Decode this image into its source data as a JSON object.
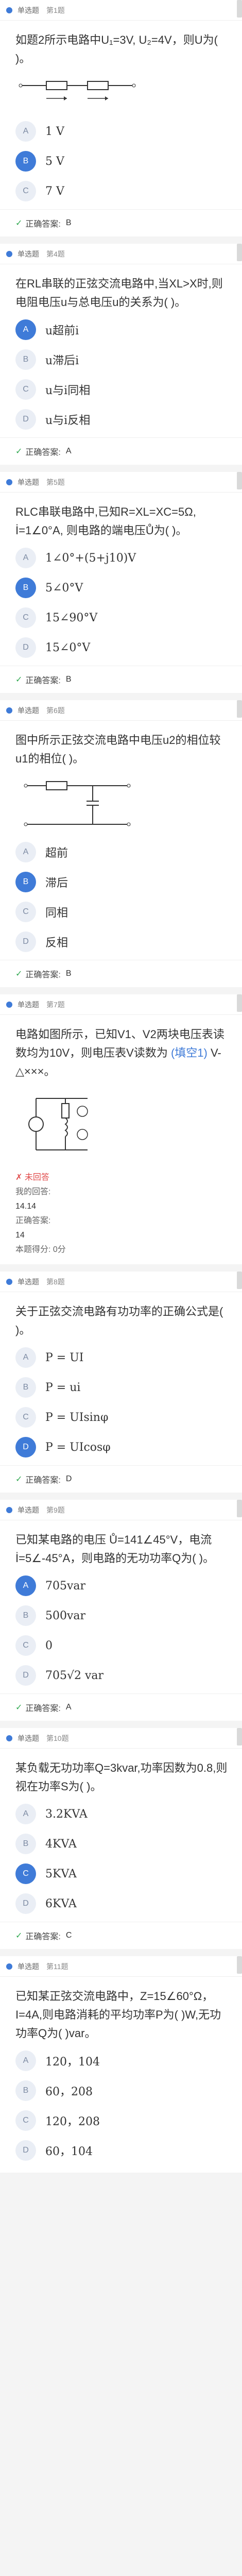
{
  "common": {
    "type": "单选题",
    "q_prefix": "第",
    "q_suffix": "题",
    "answered_correct": "正确答案:",
    "check": "✓"
  },
  "questions": [
    {
      "num": "1",
      "stem": "如题2所示电路中U₁=3V, U₂=4V，则U为(    )。",
      "figure": "series-arrows",
      "options": [
        {
          "letter": "A",
          "text": "1 V"
        },
        {
          "letter": "B",
          "text": "5 V"
        },
        {
          "letter": "C",
          "text": "7 V"
        }
      ],
      "selected": 1,
      "answer": "B"
    },
    {
      "num": "4",
      "stem": "在RL串联的正弦交流电路中,当XL>X时,则电阻电压u与总电压u的关系为(    )。",
      "options": [
        {
          "letter": "A",
          "text": "u超前i"
        },
        {
          "letter": "B",
          "text": "u滞后i"
        },
        {
          "letter": "C",
          "text": "u与i同相"
        },
        {
          "letter": "D",
          "text": "u与i反相"
        }
      ],
      "selected": 0,
      "answer": "A"
    },
    {
      "num": "5",
      "stem": "RLC串联电路中,已知R=XL=XC=5Ω, İ=1∠0°A, 则电路的端电压Ů为(    )。",
      "options": [
        {
          "letter": "A",
          "text": "1∠0°+(5+j10)V"
        },
        {
          "letter": "B",
          "text": "5∠0°V"
        },
        {
          "letter": "C",
          "text": "15∠90°V"
        },
        {
          "letter": "D",
          "text": "15∠0°V"
        }
      ],
      "selected": 1,
      "answer": "B"
    },
    {
      "num": "6",
      "stem": "图中所示正弦交流电路中电压u2的相位较u1的相位(    )。",
      "figure": "rc-network",
      "options": [
        {
          "letter": "A",
          "text": "超前"
        },
        {
          "letter": "B",
          "text": "滞后"
        },
        {
          "letter": "C",
          "text": "同相"
        },
        {
          "letter": "D",
          "text": "反相"
        }
      ],
      "selected": 1,
      "answer": "B"
    },
    {
      "num": "7",
      "stem_parts": [
        "电路如图所示，已知V1、V2两块电压表读数均为10V，则电压表V读数为 ",
        "(填空1)",
        " V-△×××。"
      ],
      "figure": "voltmeter-circuit",
      "fill_status": "未回答",
      "answer_label": "我的回答:",
      "answer_val": "14.14",
      "correct_label": "正确答案:",
      "correct_val": "14",
      "score_label": "本题得分:",
      "score_val": "0分"
    },
    {
      "num": "8",
      "stem": "关于正弦交流电路有功功率的正确公式是(    )。",
      "options": [
        {
          "letter": "A",
          "text": "P = UI"
        },
        {
          "letter": "B",
          "text": "P = ui"
        },
        {
          "letter": "C",
          "text": "P = UIsinφ"
        },
        {
          "letter": "D",
          "text": "P = UIcosφ"
        }
      ],
      "selected": 3,
      "answer": "D"
    },
    {
      "num": "9",
      "stem": "已知某电路的电压 Ů=141∠45°V，电流 İ=5∠-45°A，则电路的无功功率Q为(    )。",
      "options": [
        {
          "letter": "A",
          "text": "705var"
        },
        {
          "letter": "B",
          "text": "500var"
        },
        {
          "letter": "C",
          "text": "0"
        },
        {
          "letter": "D",
          "text": "705√2 var"
        }
      ],
      "selected": 0,
      "answer": "A"
    },
    {
      "num": "10",
      "stem": "某负载无功功率Q=3kvar,功率因数为0.8,则视在功率S为(    )。",
      "options": [
        {
          "letter": "A",
          "text": "3.2KVA"
        },
        {
          "letter": "B",
          "text": "4KVA"
        },
        {
          "letter": "C",
          "text": "5KVA"
        },
        {
          "letter": "D",
          "text": "6KVA"
        }
      ],
      "selected": 2,
      "answer": "C"
    },
    {
      "num": "11",
      "stem": "已知某正弦交流电路中，Z=15∠60°Ω，I=4A,则电路消耗的平均功率P为(    )W,无功功率Q为(    )var。",
      "options": [
        {
          "letter": "A",
          "text": "120，104"
        },
        {
          "letter": "B",
          "text": "60，208"
        },
        {
          "letter": "C",
          "text": "120，208"
        },
        {
          "letter": "D",
          "text": "60，104"
        }
      ],
      "selected": -1,
      "answer": ""
    }
  ]
}
